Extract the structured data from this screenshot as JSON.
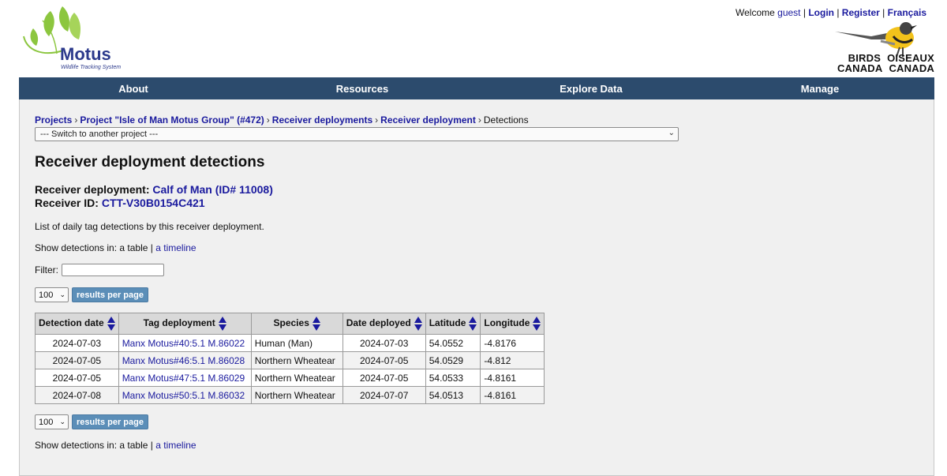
{
  "logo": {
    "name": "Motus",
    "tagline": "Wildlife Tracking System"
  },
  "top_links": {
    "welcome": "Welcome",
    "guest": "guest",
    "login": "Login",
    "register": "Register",
    "language": "Français"
  },
  "partner": {
    "line1_left": "BIRDS",
    "line1_right": "OISEAUX",
    "line2_left": "CANADA",
    "line2_right": "CANADA"
  },
  "nav": [
    "About",
    "Resources",
    "Explore Data",
    "Manage"
  ],
  "breadcrumb": [
    "Projects",
    "Project \"Isle of Man Motus Group\" (#472)",
    "Receiver deployments",
    "Receiver deployment",
    "Detections"
  ],
  "project_switcher": "--- Switch to another project ---",
  "page_title": "Receiver deployment detections",
  "deployment": {
    "label": "Receiver deployment:",
    "value": "Calf of Man (ID# 11008)",
    "receiver_label": "Receiver ID:",
    "receiver_value": "CTT-V30B0154C421"
  },
  "description": "List of daily tag detections by this receiver deployment.",
  "show_in": {
    "label": "Show detections in:",
    "table": "a table",
    "sep": "|",
    "timeline": "a timeline"
  },
  "filter_label": "Filter:",
  "pager": {
    "per_page": "100",
    "button": "results per page"
  },
  "table": {
    "columns": [
      "Detection date",
      "Tag deployment",
      "Species",
      "Date deployed",
      "Latitude",
      "Longitude"
    ],
    "rows": [
      [
        "2024-07-03",
        "Manx Motus#40:5.1 M.86022",
        "Human (Man)",
        "2024-07-03",
        "54.0552",
        "-4.8176"
      ],
      [
        "2024-07-05",
        "Manx Motus#46:5.1 M.86028",
        "Northern Wheatear",
        "2024-07-05",
        "54.0529",
        "-4.812"
      ],
      [
        "2024-07-05",
        "Manx Motus#47:5.1 M.86029",
        "Northern Wheatear",
        "2024-07-05",
        "54.0533",
        "-4.8161"
      ],
      [
        "2024-07-08",
        "Manx Motus#50:5.1 M.86032",
        "Northern Wheatear",
        "2024-07-07",
        "54.0513",
        "-4.8161"
      ]
    ]
  },
  "colors": {
    "nav_bg": "#2c4b6d",
    "link": "#1a1a9e",
    "button": "#5b8eb8",
    "logo_green": "#8cc63f",
    "logo_blue": "#2c3a8c"
  }
}
